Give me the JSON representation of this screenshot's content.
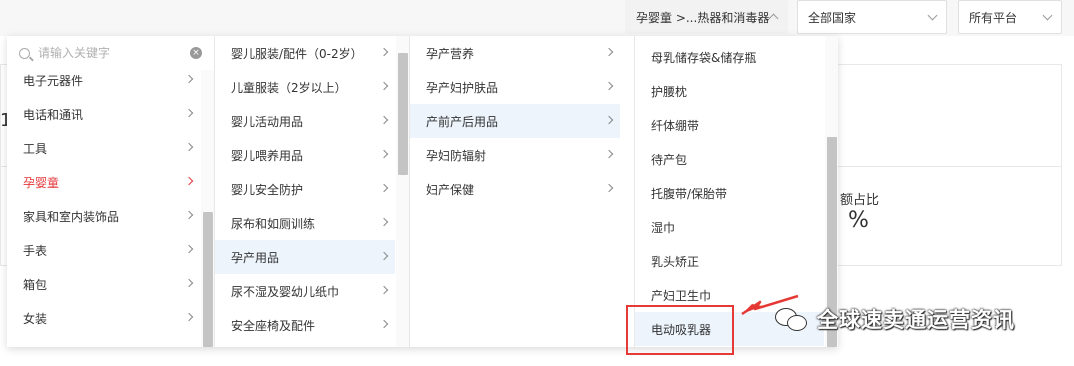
{
  "filters": {
    "category": "孕婴童 >...热器和消毒器",
    "country": "全部国家",
    "platform": "所有平台"
  },
  "search": {
    "placeholder": "请输入关键字"
  },
  "background": {
    "label": "额占比",
    "value": "%",
    "frag1": "1"
  },
  "cascader": {
    "col1": [
      {
        "label": "电子元器件",
        "arrow": true
      },
      {
        "label": "电话和通讯",
        "arrow": true
      },
      {
        "label": "工具",
        "arrow": true
      },
      {
        "label": "孕婴童",
        "arrow": true,
        "active": true
      },
      {
        "label": "家具和室内装饰品",
        "arrow": true
      },
      {
        "label": "手表",
        "arrow": true
      },
      {
        "label": "箱包",
        "arrow": true
      },
      {
        "label": "女装",
        "arrow": true
      }
    ],
    "col2": [
      {
        "label": "婴儿服装/配件（0-2岁）",
        "arrow": true
      },
      {
        "label": "儿童服装（2岁以上）",
        "arrow": true
      },
      {
        "label": "婴儿活动用品",
        "arrow": true
      },
      {
        "label": "婴儿喂养用品",
        "arrow": true
      },
      {
        "label": "婴儿安全防护",
        "arrow": true
      },
      {
        "label": "尿布和如厕训练",
        "arrow": true
      },
      {
        "label": "孕产用品",
        "arrow": true,
        "selected": true
      },
      {
        "label": "尿不湿及婴幼儿纸巾",
        "arrow": true
      },
      {
        "label": "安全座椅及配件",
        "arrow": true
      }
    ],
    "col3": [
      {
        "label": "孕产营养",
        "arrow": true
      },
      {
        "label": "孕产妇护肤品",
        "arrow": true
      },
      {
        "label": "产前产后用品",
        "arrow": true,
        "selected": true
      },
      {
        "label": "孕妇防辐射",
        "arrow": true
      },
      {
        "label": "妇产保健",
        "arrow": true
      }
    ],
    "col4": [
      {
        "label": "母乳储存袋&储存瓶"
      },
      {
        "label": "护腰枕"
      },
      {
        "label": "纤体绷带"
      },
      {
        "label": "待产包"
      },
      {
        "label": "托腹带/保胎带"
      },
      {
        "label": "湿巾"
      },
      {
        "label": "乳头矫正"
      },
      {
        "label": "产妇卫生巾"
      },
      {
        "label": "电动吸乳器",
        "selected": true
      }
    ]
  },
  "watermark": {
    "text": "全球速卖通运营资讯",
    "icon": "wechat-icon"
  },
  "colors": {
    "active_red": "#e4393c",
    "selected_bg": "#edf4fc",
    "highlight_red": "#e53935"
  }
}
